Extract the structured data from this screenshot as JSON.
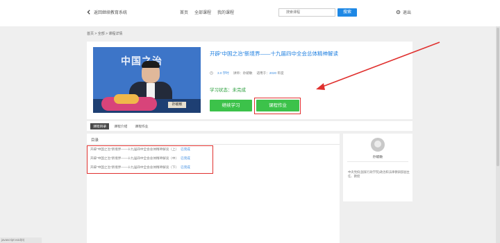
{
  "header": {
    "brand": "返回继续教育系统",
    "nav": [
      "首页",
      "全部课程",
      "我的课程"
    ],
    "search_placeholder": "搜索课程",
    "search_button": "搜索",
    "logout": "退出"
  },
  "breadcrumb": "首页 > 全部 > 课程详情",
  "course": {
    "thumb_text": "中国之治",
    "nameplate": "孙毓敏",
    "title": "开辟“中国之治”新境界——十九届四中全会总体精神解读",
    "meta": {
      "hours": "3.0 学时",
      "teacher_label": "讲师：",
      "teacher": "孙毓敏",
      "year_label": "适用于：",
      "year": "2020",
      "year_suffix": "年度"
    },
    "status": "学习状态：未完成",
    "continue_button": "继续学习",
    "homework_button": "课程作业"
  },
  "tabs": [
    "课程目录",
    "课程介绍",
    "课程作业"
  ],
  "catalog": {
    "title": "目录",
    "lessons": [
      {
        "title": "开辟“中国之治”新境界——十九届四中全会总体精神解读（上）",
        "tag": "已完成"
      },
      {
        "title": "开辟“中国之治”新境界——十九届四中全会总体精神解读（中）",
        "tag": "已完成"
      },
      {
        "title": "开辟“中国之治”新境界——十九届四中全会总体精神解读（下）",
        "tag": "已完成"
      }
    ]
  },
  "teacher_card": {
    "name": "孙毓敏",
    "desc": "中央党校(国家行政学院)政治和法律教研部副主任、教授"
  },
  "status_url": "javascript:void(0)",
  "colors": {
    "accent_blue": "#1e88e5",
    "green_button": "#3cc24a",
    "highlight_red": "#e0302e"
  }
}
